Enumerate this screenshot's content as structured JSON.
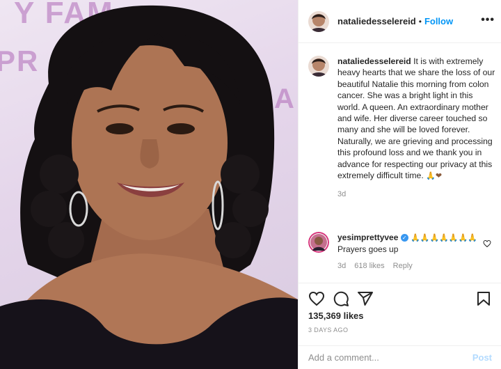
{
  "photo": {
    "backdrop_text_top": "Y FAM",
    "backdrop_text_left": "PR",
    "backdrop_text_right": "A"
  },
  "header": {
    "username": "nataliedesselereid",
    "separator": "•",
    "follow_label": "Follow",
    "more_label": "•••"
  },
  "caption": {
    "username": "nataliedesselereid",
    "text": "It is with extremely heavy hearts that we share the loss of our beautiful Natalie this morning from colon cancer. She was a bright light in this world. A queen. An extraordinary mother and wife. Her diverse career touched so many and she will be loved forever. Naturally, we are grieving and processing this profound loss and we thank you in advance for respecting our privacy at this extremely difficult time.",
    "emoji": "🙏❤",
    "time": "3d"
  },
  "comment": {
    "username": "yesimprettyvee",
    "verified_mark": "✓",
    "emoji": "🙏🙏🙏🙏🙏🙏🙏",
    "text": "Prayers goes up",
    "time": "3d",
    "likes": "618 likes",
    "reply": "Reply"
  },
  "post": {
    "likes": "135,369 likes",
    "time_ago": "3 DAYS AGO"
  },
  "add_comment": {
    "placeholder": "Add a comment...",
    "post_label": "Post"
  },
  "icons": [
    "heart-icon",
    "comment-icon",
    "share-icon",
    "bookmark-icon",
    "more-icon"
  ]
}
